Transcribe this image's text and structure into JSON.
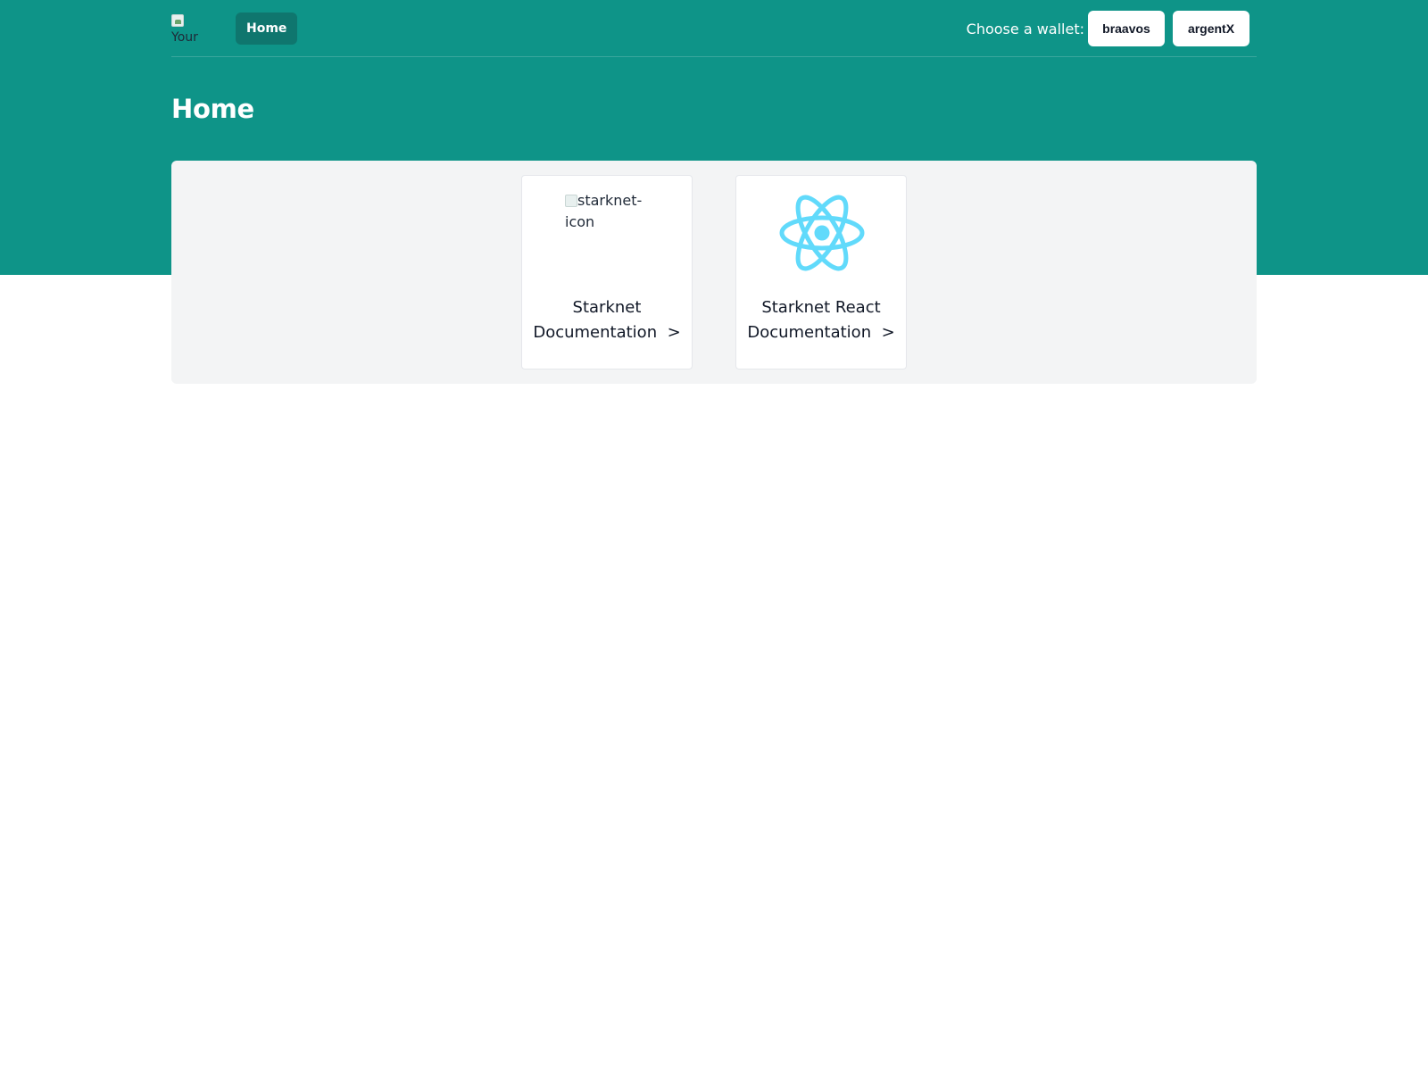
{
  "header": {
    "logo_alt": "Your",
    "nav_home": "Home",
    "wallet_label": "Choose a wallet:",
    "wallets": [
      "braavos",
      "argentX"
    ]
  },
  "page": {
    "title": "Home"
  },
  "cards": [
    {
      "image_alt": "starknet-icon",
      "title_line1": "Starknet",
      "title_line2": "Documentation",
      "arrow": ">"
    },
    {
      "icon": "react-icon",
      "title_line1": "Starknet React",
      "title_line2": "Documentation",
      "arrow": ">"
    }
  ],
  "colors": {
    "brand_teal": "#0e9488",
    "nav_active": "#0f766e",
    "react_blue": "#61dafb",
    "panel_bg": "#f3f4f5"
  }
}
